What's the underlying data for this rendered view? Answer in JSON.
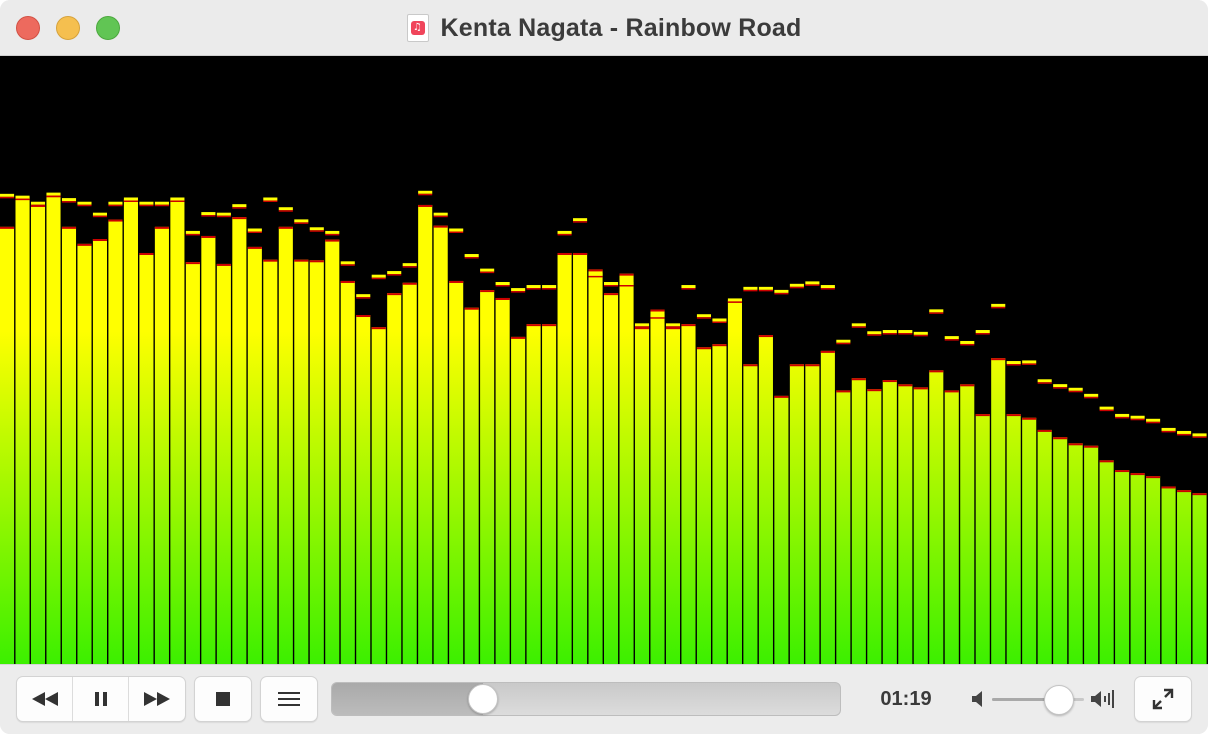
{
  "window": {
    "title": "Kenta Nagata - Rainbow Road",
    "file_icon": "music-note-icon",
    "file_icon_glyph": "♫"
  },
  "visualizer": {
    "colors": {
      "top": "#ffff00",
      "bottom": "#3cf000",
      "peak": "#ffff00",
      "peak_edge": "#cc0000",
      "background": "#000000"
    },
    "bars": [
      0.719,
      0.767,
      0.755,
      0.771,
      0.719,
      0.691,
      0.699,
      0.731,
      0.764,
      0.676,
      0.719,
      0.764,
      0.661,
      0.704,
      0.658,
      0.735,
      0.686,
      0.665,
      0.719,
      0.665,
      0.664,
      0.698,
      0.63,
      0.574,
      0.554,
      0.61,
      0.627,
      0.755,
      0.721,
      0.63,
      0.586,
      0.615,
      0.602,
      0.538,
      0.559,
      0.559,
      0.676,
      0.676,
      0.649,
      0.61,
      0.642,
      0.554,
      0.583,
      0.554,
      0.559,
      0.521,
      0.526,
      0.598,
      0.493,
      0.541,
      0.441,
      0.493,
      0.493,
      0.515,
      0.45,
      0.47,
      0.452,
      0.467,
      0.46,
      0.455,
      0.483,
      0.45,
      0.46,
      0.411,
      0.503,
      0.411,
      0.405,
      0.385,
      0.373,
      0.363,
      0.359,
      0.335,
      0.319,
      0.314,
      0.309,
      0.292,
      0.286,
      0.281
    ],
    "peaks": [
      0.77,
      0.767,
      0.757,
      0.772,
      0.763,
      0.757,
      0.739,
      0.757,
      0.764,
      0.757,
      0.757,
      0.764,
      0.709,
      0.74,
      0.739,
      0.753,
      0.713,
      0.764,
      0.748,
      0.728,
      0.715,
      0.709,
      0.659,
      0.605,
      0.637,
      0.643,
      0.656,
      0.775,
      0.739,
      0.713,
      0.671,
      0.647,
      0.625,
      0.615,
      0.62,
      0.62,
      0.709,
      0.73,
      0.64,
      0.625,
      0.625,
      0.557,
      0.572,
      0.557,
      0.62,
      0.572,
      0.565,
      0.598,
      0.617,
      0.617,
      0.612,
      0.622,
      0.626,
      0.62,
      0.53,
      0.557,
      0.544,
      0.546,
      0.546,
      0.543,
      0.58,
      0.536,
      0.528,
      0.546,
      0.589,
      0.495,
      0.496,
      0.465,
      0.457,
      0.451,
      0.441,
      0.42,
      0.408,
      0.405,
      0.4,
      0.385,
      0.38,
      0.376
    ]
  },
  "controls": {
    "rewind_icon": "rewind-icon",
    "pause_icon": "pause-icon",
    "fastforward_icon": "fast-forward-icon",
    "stop_icon": "stop-icon",
    "playlist_icon": "playlist-icon",
    "fullscreen_icon": "fullscreen-icon",
    "time_elapsed": "01:19",
    "seek_position": 0.297,
    "volume_level": 0.73
  }
}
